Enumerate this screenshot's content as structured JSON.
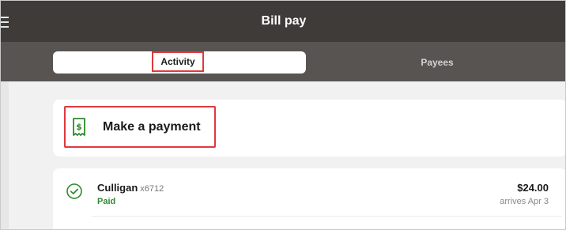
{
  "header": {
    "title": "Bill pay",
    "menu_icon": "hamburger-menu-icon"
  },
  "tabs": [
    {
      "label": "Activity",
      "selected": true
    },
    {
      "label": "Payees",
      "selected": false
    }
  ],
  "make_payment": {
    "label": "Make a payment",
    "icon": "receipt-dollar-icon"
  },
  "activity": [
    {
      "payee": "Culligan",
      "account": "x6712",
      "status": "Paid",
      "amount": "$24.00",
      "arrival": "arrives Apr 3",
      "status_icon": "check-circle-icon"
    }
  ],
  "colors": {
    "header_bg": "#3e3b38",
    "segbar_bg": "#575451",
    "accent_green": "#2e8b2e",
    "highlight_red": "#e0383e"
  }
}
